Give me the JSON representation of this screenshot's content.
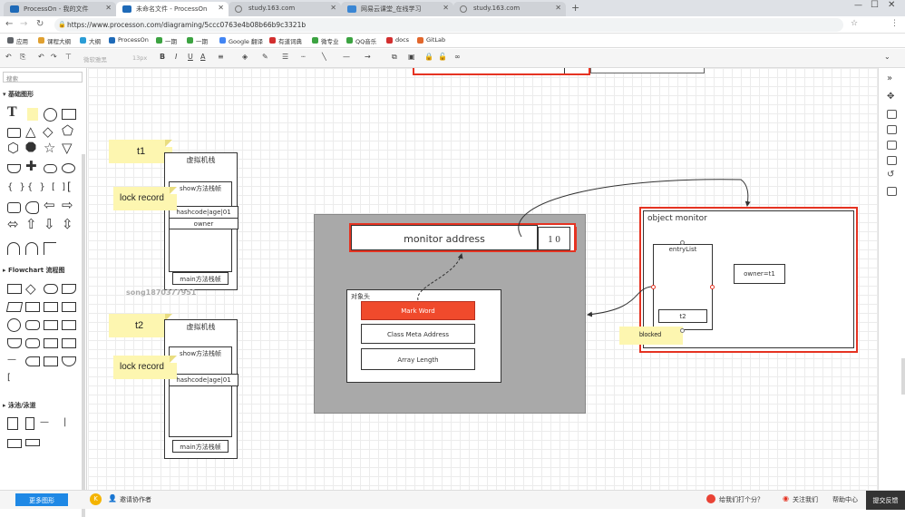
{
  "browser": {
    "tabs": [
      {
        "label": "ProcessOn - 我的文件"
      },
      {
        "label": "未命名文件 - ProcessOn"
      },
      {
        "label": "study.163.com"
      },
      {
        "label": "网易云课堂_在线学习"
      },
      {
        "label": "study.163.com"
      }
    ],
    "url": "https://www.processon.com/diagraming/5ccc0763e4b08b66b9c3321b",
    "bookmarks": [
      "应用",
      "课程大纲",
      "大纲",
      "ProcessOn",
      "一期",
      "一期",
      "Google 翻译",
      "有道词典",
      "微专业",
      "QQ音乐",
      "docs",
      "GitLab"
    ]
  },
  "toolbar": {
    "font_name": "微软雅黑",
    "font_size": "13px",
    "bold": "B",
    "italic": "I",
    "underline": "U",
    "font_color": "A"
  },
  "sidebar": {
    "search_placeholder": "搜索",
    "section_basic": "基础图形",
    "section_flowchart": "Flowchart 流程图",
    "section_swimlane": "泳池/泳道"
  },
  "canvas": {
    "t1_note": "t1",
    "t2_note": "t2",
    "lock_record_1": "lock record",
    "lock_record_2": "lock record",
    "jvm_stack_1": {
      "title": "虚拟机栈",
      "frame_show": "show方法栈帧",
      "hashcode": "hashcode|age|01",
      "owner": "owner",
      "main_frame": "main方法栈帧"
    },
    "watermark": "song1870377951",
    "jvm_stack_2": {
      "title": "虚拟机栈",
      "frame_show": "show方法栈帧",
      "hashcode": "hashcode|age|01",
      "main_frame": "main方法栈帧"
    },
    "monitor_address": "monitor address",
    "lock_bits": "1 0",
    "object_header": {
      "title": "对象头",
      "mark_word": "Mark Word",
      "class_meta": "Class Meta Address",
      "array_length": "Array Length"
    },
    "object_monitor": {
      "title": "object monitor",
      "entry_list": "entryList",
      "t2": "t2",
      "owner": "owner=t1",
      "blocked": "blocked"
    }
  },
  "statusbar": {
    "more_shapes": "更多图形",
    "invite": "邀请协作者",
    "rate": "给我们打个分？",
    "follow": "关注我们",
    "help": "帮助中心",
    "feedback": "提交反馈"
  },
  "colors": {
    "accent_red": "#e53322",
    "mark_word_red": "#f04a2c",
    "sticky_yellow": "#fdf6b0",
    "panel_gray": "#a9a9a9",
    "more_shapes_blue": "#1e88e5"
  }
}
